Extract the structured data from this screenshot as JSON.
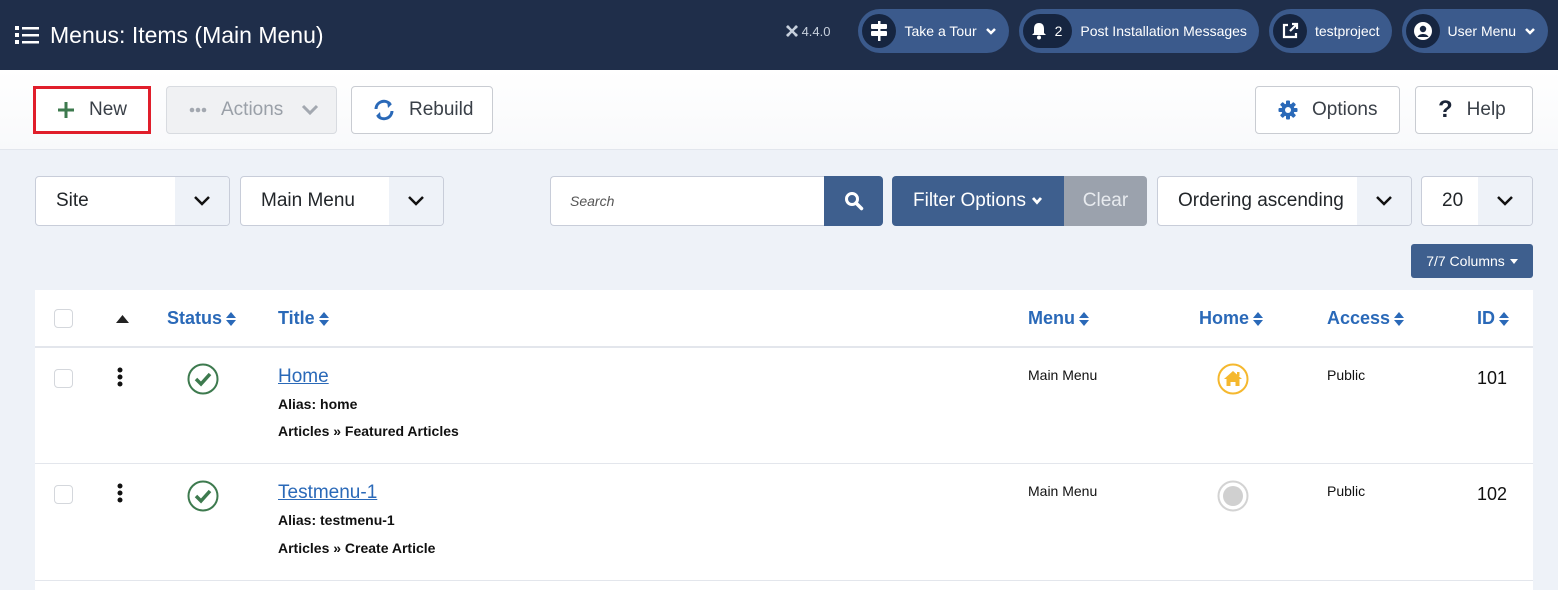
{
  "header": {
    "title": "Menus: Items (Main Menu)",
    "version": "4.4.0",
    "tour_label": "Take a Tour",
    "notifications_count": "2",
    "post_install_label": "Post Installation Messages",
    "site_label": "testproject",
    "user_menu_label": "User Menu"
  },
  "toolbar": {
    "new_label": "New",
    "actions_label": "Actions",
    "rebuild_label": "Rebuild",
    "options_label": "Options",
    "help_label": "Help"
  },
  "filters": {
    "client": "Site",
    "menu": "Main Menu",
    "search_placeholder": "Search",
    "filter_options_label": "Filter Options",
    "clear_label": "Clear",
    "ordering": "Ordering ascending",
    "limit": "20",
    "columns_label": "7/7 Columns"
  },
  "table": {
    "columns": [
      "Status",
      "Title",
      "Menu",
      "Home",
      "Access",
      "ID"
    ],
    "rows": [
      {
        "title": "Home",
        "alias": "Alias: home",
        "type": "Articles » Featured Articles",
        "menu": "Main Menu",
        "home": "default",
        "access": "Public",
        "id": "101",
        "status": "published"
      },
      {
        "title": "Testmenu-1",
        "alias": "Alias: testmenu-1",
        "type": "Articles » Create Article",
        "menu": "Main Menu",
        "home": "not-default",
        "access": "Public",
        "id": "102",
        "status": "published"
      }
    ]
  },
  "colors": {
    "header_bg": "#1f2e4a",
    "pill_bg": "#3b5a8c",
    "accent": "#3e5f8e",
    "link": "#2a69b8",
    "published": "#3d7a4e",
    "home_default": "#f5b82e",
    "highlight": "#e01e2b"
  }
}
